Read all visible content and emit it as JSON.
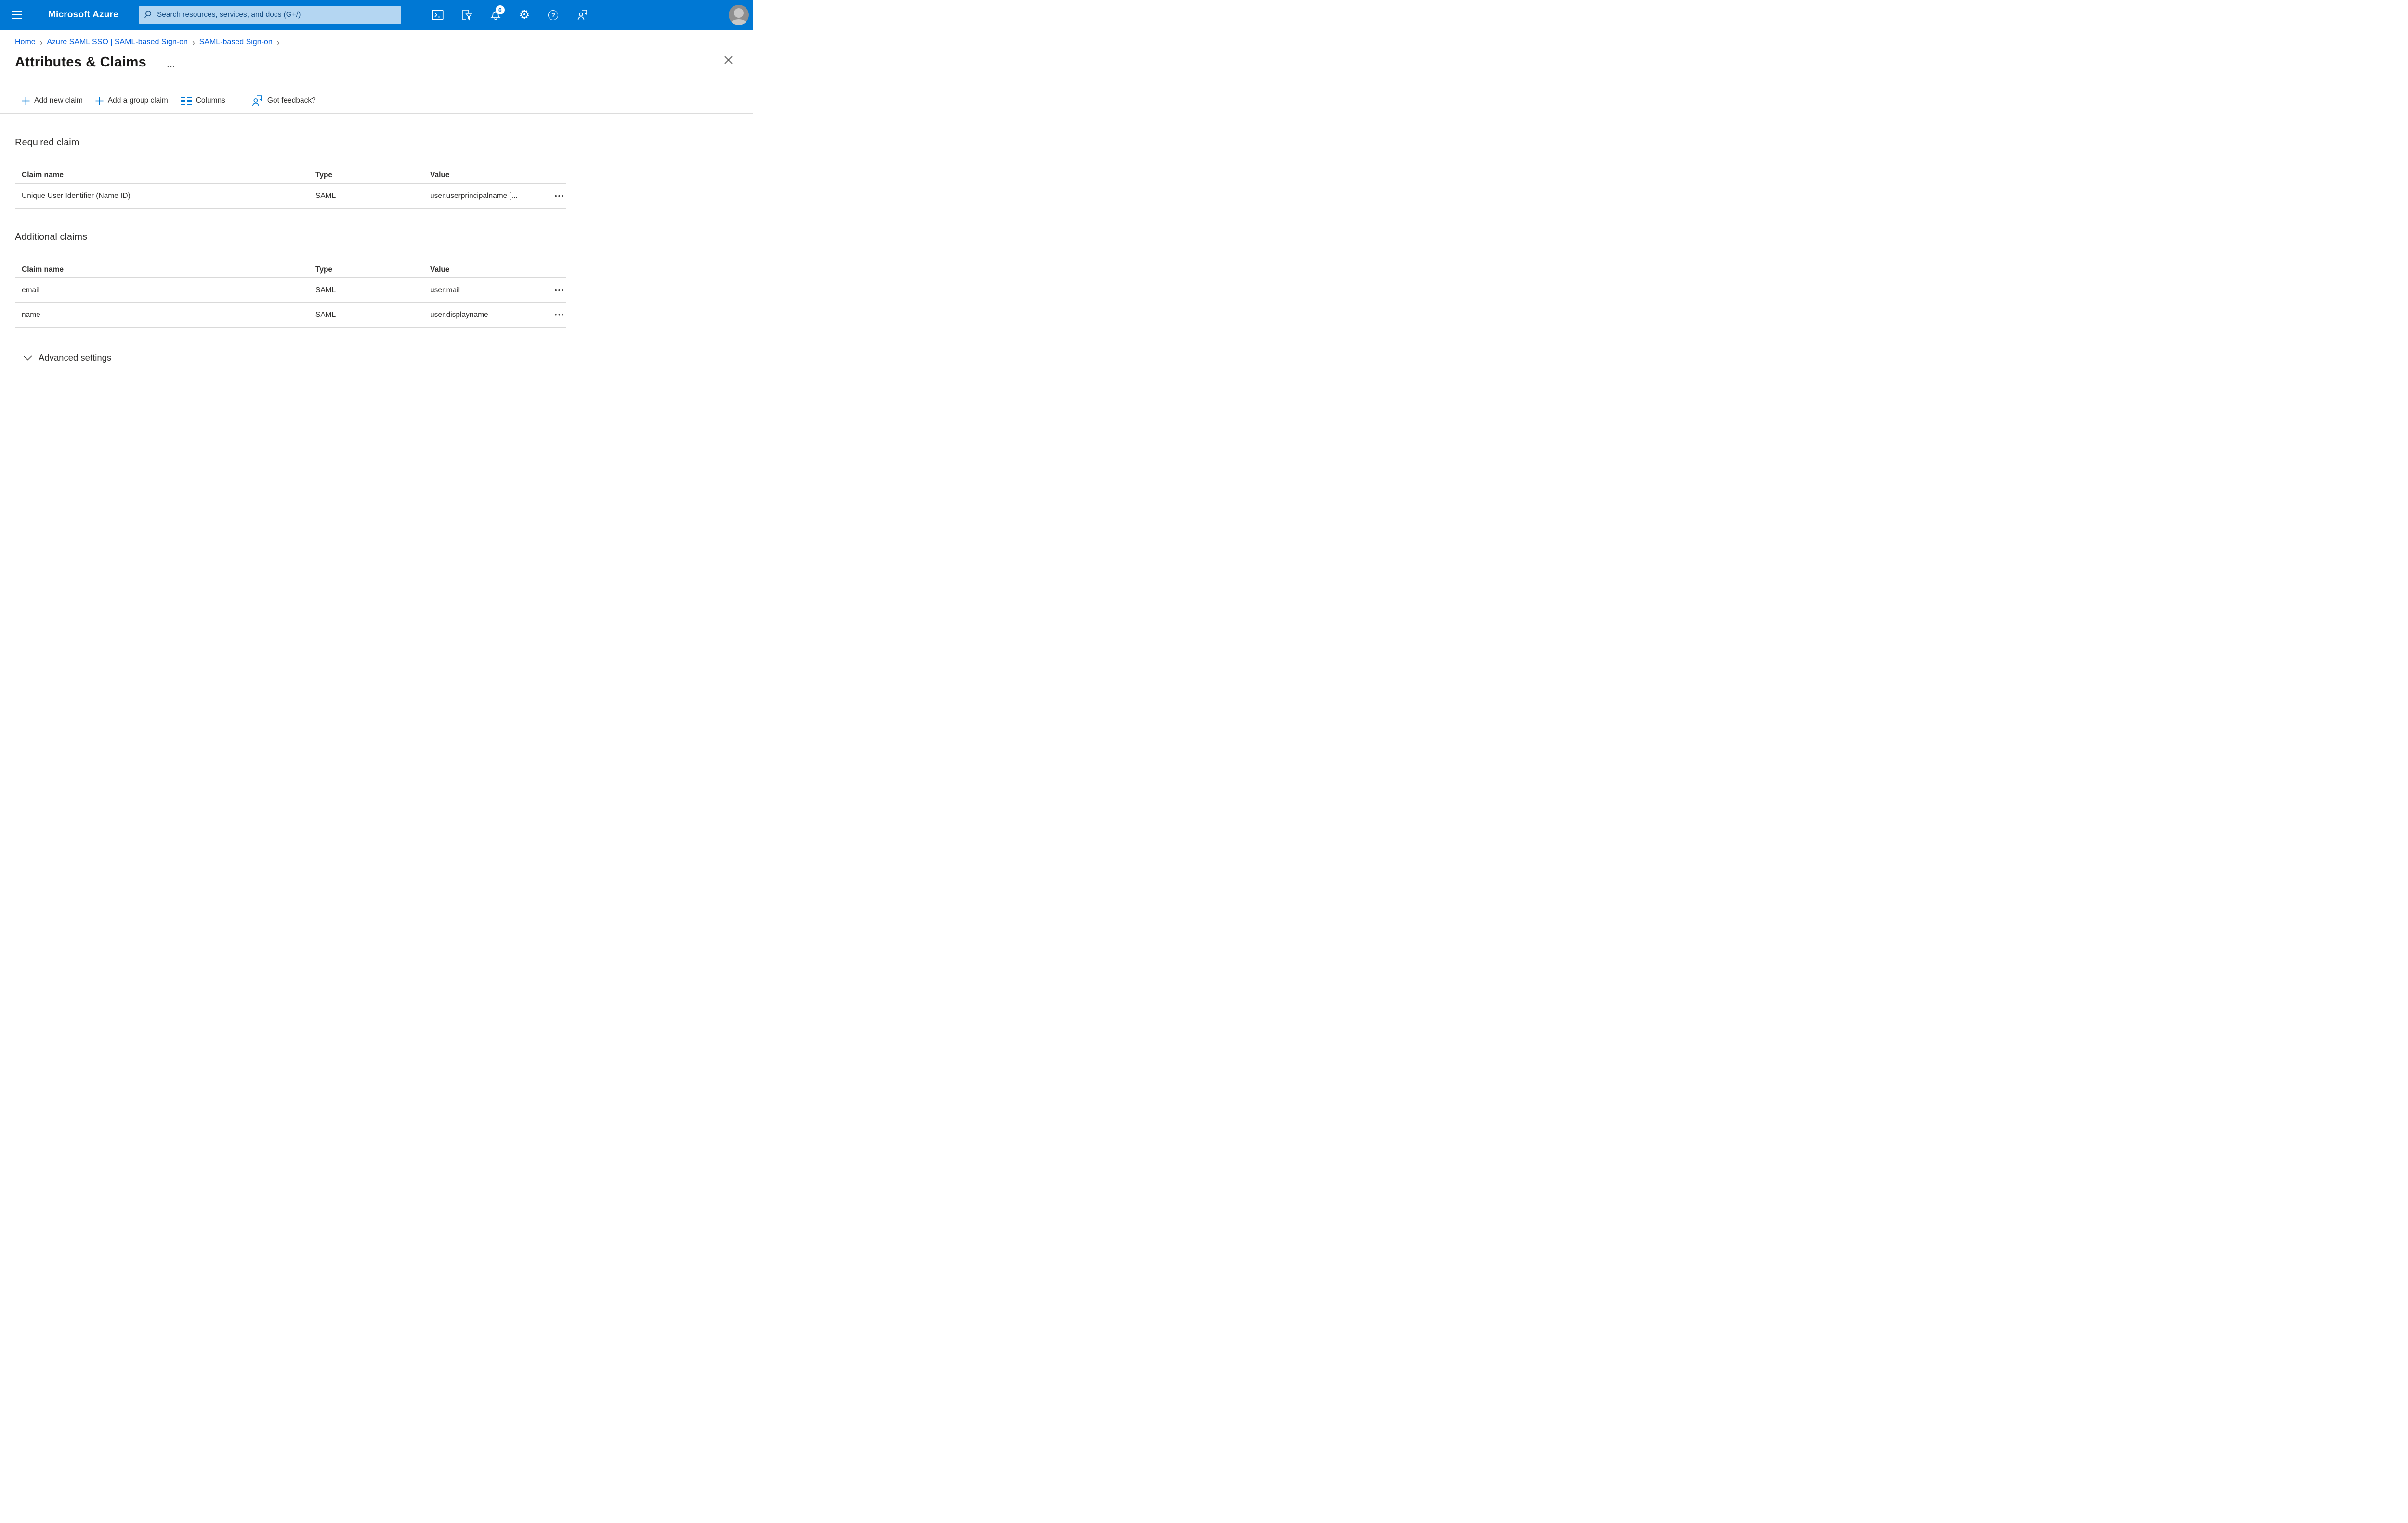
{
  "colors": {
    "header_bg": "#0078d4",
    "search_bg": "#b4d6f2",
    "search_text": "#174f85",
    "link_blue": "#015cda",
    "accent_blue": "#0078d4",
    "text_primary": "#323130",
    "divider": "#d9d9d9"
  },
  "topbar": {
    "brand": "Microsoft Azure",
    "search_placeholder": "Search resources, services, and docs (G+/)",
    "notification_count": "6",
    "icons": [
      "hamburger-icon",
      "search-icon",
      "cloud-shell-icon",
      "directory-filter-icon",
      "bell-icon",
      "gear-icon",
      "help-icon",
      "feedback-icon",
      "avatar"
    ],
    "gear_glyph": "⚙",
    "help_glyph": "?"
  },
  "breadcrumb": {
    "separator": "›",
    "items": [
      {
        "label": "Home"
      },
      {
        "label": "Azure SAML SSO | SAML-based Sign-on"
      },
      {
        "label": "SAML-based Sign-on"
      }
    ]
  },
  "page": {
    "title": "Attributes & Claims",
    "more_label": "…"
  },
  "toolbar": {
    "add_new_claim": "Add new claim",
    "add_group_claim": "Add a group claim",
    "columns": "Columns",
    "got_feedback": "Got feedback?"
  },
  "ui": {
    "row_menu": "•••"
  },
  "required_claim": {
    "heading": "Required claim",
    "columns": [
      "Claim name",
      "Type",
      "Value"
    ],
    "rows": [
      {
        "claim_name": "Unique User Identifier (Name ID)",
        "type": "SAML",
        "value": "user.userprincipalname [..."
      }
    ]
  },
  "additional_claims": {
    "heading": "Additional claims",
    "columns": [
      "Claim name",
      "Type",
      "Value"
    ],
    "rows": [
      {
        "claim_name": "email",
        "type": "SAML",
        "value": "user.mail"
      },
      {
        "claim_name": "name",
        "type": "SAML",
        "value": "user.displayname"
      }
    ]
  },
  "advanced_settings": {
    "label": "Advanced settings"
  }
}
